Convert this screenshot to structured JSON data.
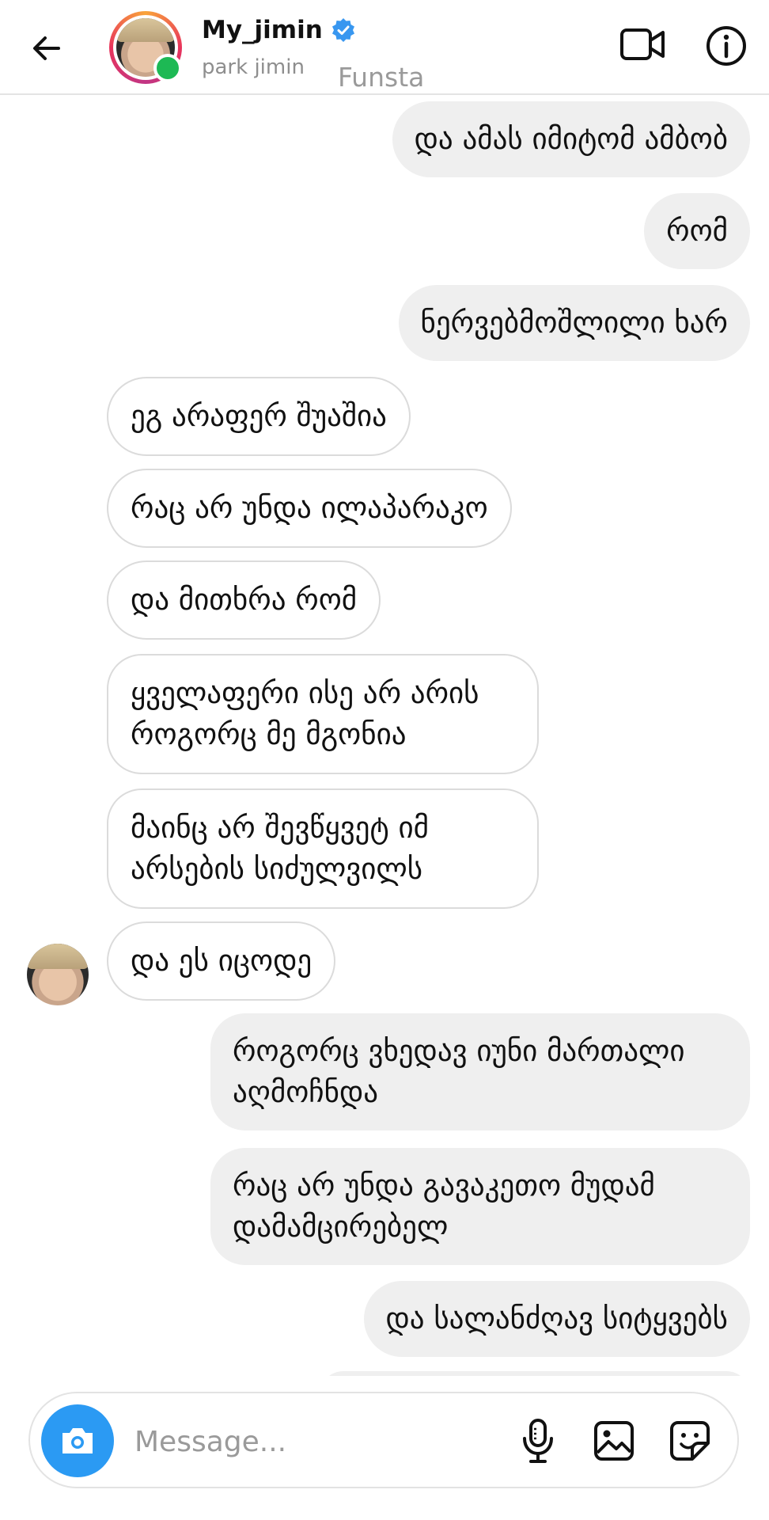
{
  "header": {
    "username": "My_jimin",
    "subname": "park jimin",
    "overlay_text": "Funsta"
  },
  "messages": [
    {
      "side": "out",
      "text": "და ამას იმიტომ ამბობ"
    },
    {
      "side": "out",
      "text": "რომ"
    },
    {
      "side": "out",
      "text": "ნერვებმოშლილი ხარ"
    },
    {
      "side": "in",
      "text": "ეგ არაფერ შუაშია"
    },
    {
      "side": "in",
      "text": "რაც არ უნდა ილაპარაკო"
    },
    {
      "side": "in",
      "text": "და მითხრა რომ"
    },
    {
      "side": "in",
      "text": "ყველაფერი ისე არ არის\nროგორც მე მგონია"
    },
    {
      "side": "in",
      "text": "მაინც არ შევწყვეტ იმ\nარსების სიძულვილს"
    },
    {
      "side": "in",
      "text": "და ეს იცოდე"
    },
    {
      "side": "out",
      "text": "როგორც ვხედავ იუნი მართალი\nაღმოჩნდა"
    },
    {
      "side": "out",
      "text": "რაც არ უნდა გავაკეთო მუდამ\nდამამცირებელ"
    },
    {
      "side": "out",
      "text": "და სალანძღავ სიტყვებს"
    }
  ],
  "composer": {
    "placeholder": "Message..."
  },
  "colors": {
    "outgoing_bubble": "#efefef",
    "incoming_border": "#dbdbdb",
    "camera_button": "#2b9af3",
    "verified_badge": "#3897f0",
    "online_dot": "#1db954"
  },
  "icons": [
    "back-arrow-icon",
    "verified-badge-icon",
    "video-call-icon",
    "info-icon",
    "camera-icon",
    "microphone-icon",
    "gallery-icon",
    "sticker-icon"
  ]
}
